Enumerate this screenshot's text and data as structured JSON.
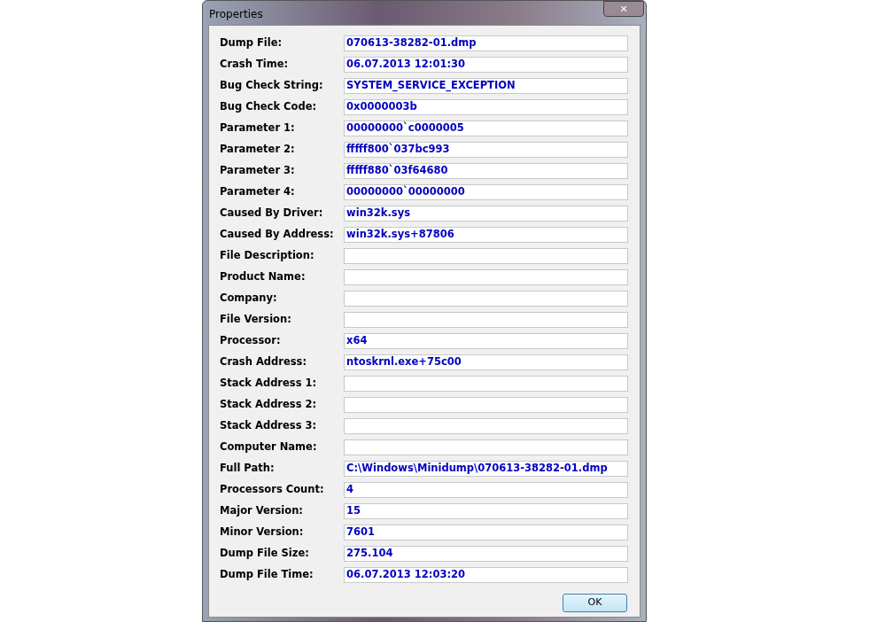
{
  "window": {
    "title": "Properties",
    "close": "✕"
  },
  "fields": [
    {
      "label": "Dump File:",
      "value": "070613-38282-01.dmp"
    },
    {
      "label": "Crash Time:",
      "value": "06.07.2013 12:01:30"
    },
    {
      "label": "Bug Check String:",
      "value": "SYSTEM_SERVICE_EXCEPTION"
    },
    {
      "label": "Bug Check Code:",
      "value": "0x0000003b"
    },
    {
      "label": "Parameter 1:",
      "value": "00000000`c0000005"
    },
    {
      "label": "Parameter 2:",
      "value": "fffff800`037bc993"
    },
    {
      "label": "Parameter 3:",
      "value": "fffff880`03f64680"
    },
    {
      "label": "Parameter 4:",
      "value": "00000000`00000000"
    },
    {
      "label": "Caused By Driver:",
      "value": "win32k.sys"
    },
    {
      "label": "Caused By Address:",
      "value": "win32k.sys+87806"
    },
    {
      "label": "File Description:"
    },
    {
      "label": "Product Name:"
    },
    {
      "label": "Company:"
    },
    {
      "label": "File Version:"
    },
    {
      "label": "Processor:",
      "value": "x64"
    },
    {
      "label": "Crash Address:",
      "value": "ntoskrnl.exe+75c00"
    },
    {
      "label": "Stack Address 1:"
    },
    {
      "label": "Stack Address 2:"
    },
    {
      "label": "Stack Address 3:"
    },
    {
      "label": "Computer Name:"
    },
    {
      "label": "Full Path:",
      "value": "C:\\Windows\\Minidump\\070613-38282-01.dmp"
    },
    {
      "label": "Processors Count:",
      "value": "4"
    },
    {
      "label": "Major Version:",
      "value": "15"
    },
    {
      "label": "Minor Version:",
      "value": "7601"
    },
    {
      "label": "Dump File Size:",
      "value": "275.104"
    },
    {
      "label": "Dump File Time:",
      "value": "06.07.2013 12:03:20"
    }
  ],
  "buttons": [
    "OK"
  ]
}
